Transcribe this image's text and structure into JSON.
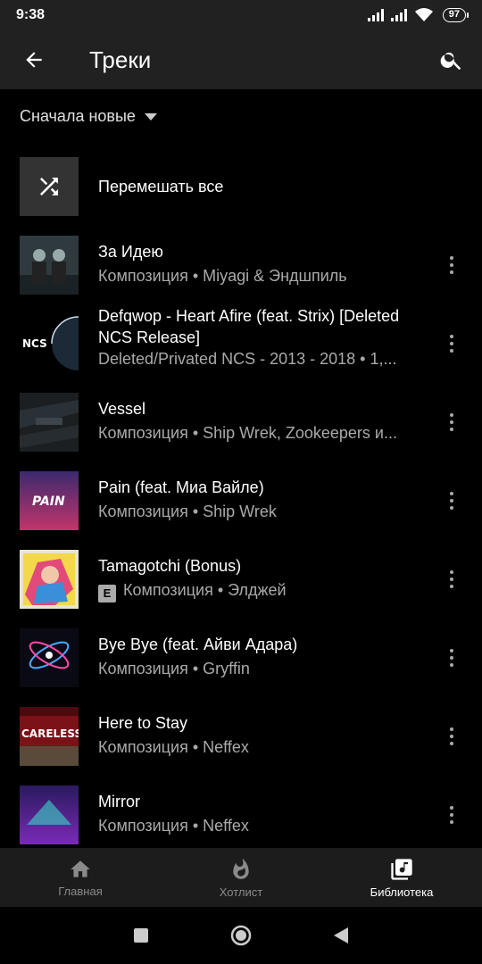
{
  "status": {
    "time": "9:38",
    "battery": "97"
  },
  "header": {
    "title": "Треки"
  },
  "sort": {
    "label": "Сначала новые"
  },
  "shuffle": {
    "label": "Перемешать все"
  },
  "tracks": [
    {
      "title": "За Идею",
      "subtitle": "Композиция • Miyagi & Эндшпиль"
    },
    {
      "title": "Defqwop - Heart Afire (feat. Strix) [Deleted NCS Release]",
      "subtitle": "Deleted/Privated NCS - 2013 - 2018 • 1,..."
    },
    {
      "title": "Vessel",
      "subtitle": "Композиция • Ship Wrek, Zookeepers и..."
    },
    {
      "title": "Pain (feat. Миа Вайле)",
      "subtitle": "Композиция • Ship Wrek"
    },
    {
      "title": "Tamagotchi (Bonus)",
      "subtitle": "Композиция • Элджей",
      "explicit": "E"
    },
    {
      "title": "Bye Bye (feat. Айви Адара)",
      "subtitle": "Композиция • Gryffin"
    },
    {
      "title": "Here to Stay",
      "subtitle": "Композиция • Neffex"
    },
    {
      "title": "Mirror",
      "subtitle": "Композиция • Neffex"
    }
  ],
  "art_text": {
    "ncs": "NCS",
    "pain": "PAIN",
    "careless": "CARELESS"
  },
  "nav": {
    "home": "Главная",
    "hotlist": "Хотлист",
    "library": "Библиотека"
  },
  "colors": {
    "background": "#000000",
    "bar": "#212121",
    "secondary_text": "#aaaaaa"
  }
}
